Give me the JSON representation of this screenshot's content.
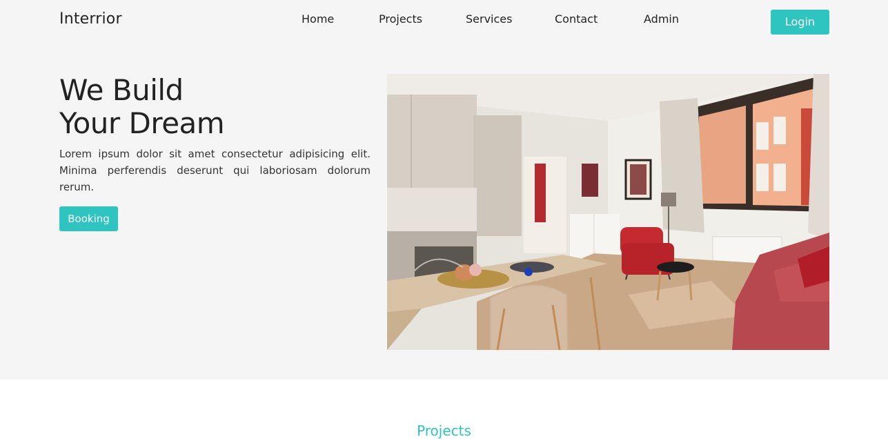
{
  "header": {
    "brand": "Interrior",
    "nav": [
      "Home",
      "Projects",
      "Services",
      "Contact",
      "Admin"
    ],
    "login_label": "Login"
  },
  "hero": {
    "title_line1": "We Build",
    "title_line2": "Your Dream",
    "description": "Lorem ipsum dolor sit amet consectetur adipisicing elit. Minima perferendis deserunt qui laboriosam dolorum rerum.",
    "booking_label": "Booking"
  },
  "sections": {
    "projects_title": "Projects"
  },
  "colors": {
    "accent": "#2ec4c0",
    "hero_bg": "#f5f5f5"
  }
}
